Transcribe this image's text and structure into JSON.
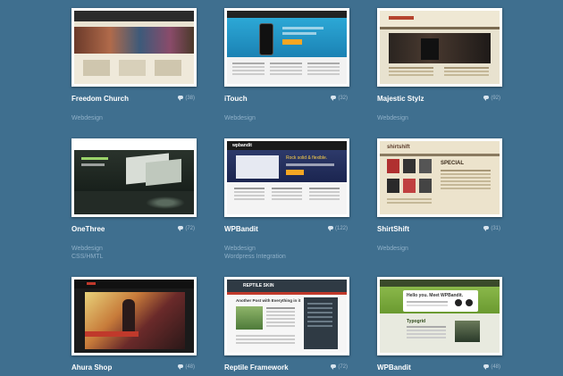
{
  "colors": {
    "background": "#3f6f8f",
    "title": "#ffffff",
    "tag": "#8fb0c8",
    "count": "#9fb8cc"
  },
  "items": [
    {
      "title": "Freedom Church",
      "comments": "(38)",
      "tags": [
        "Webdesign"
      ]
    },
    {
      "title": "iTouch",
      "comments": "(32)",
      "tags": [
        "Webdesign"
      ]
    },
    {
      "title": "Majestic Stylz",
      "comments": "(92)",
      "tags": [
        "Webdesign"
      ]
    },
    {
      "title": "OneThree",
      "comments": "(72)",
      "tags": [
        "Webdesign",
        "CSS/HMTL"
      ]
    },
    {
      "title": "WPBandit",
      "comments": "(122)",
      "tags": [
        "Webdesign",
        "Wordpress Integration"
      ]
    },
    {
      "title": "ShirtShift",
      "comments": "(31)",
      "tags": [
        "Webdesign"
      ]
    },
    {
      "title": "Ahura Shop",
      "comments": "(48)",
      "tags": []
    },
    {
      "title": "Reptile Framework",
      "comments": "(72)",
      "tags": []
    },
    {
      "title": "WPBandit",
      "comments": "(48)",
      "tags": []
    }
  ],
  "thumb_text": {
    "reptile_logo": "REPTILE SKIN",
    "reptile_heading": "Another Post with Everything in it",
    "wpbandit_hello": "Hello you. Meet WPBandit.",
    "wpbandit_typogrid": "Typogrid",
    "shirtshift_logo": "shirtshift",
    "shirtshift_special": "SPECIAL",
    "wpbandit2_logo": "wpbandit",
    "wpbandit2_tagline": "Rock solid & flexible."
  }
}
